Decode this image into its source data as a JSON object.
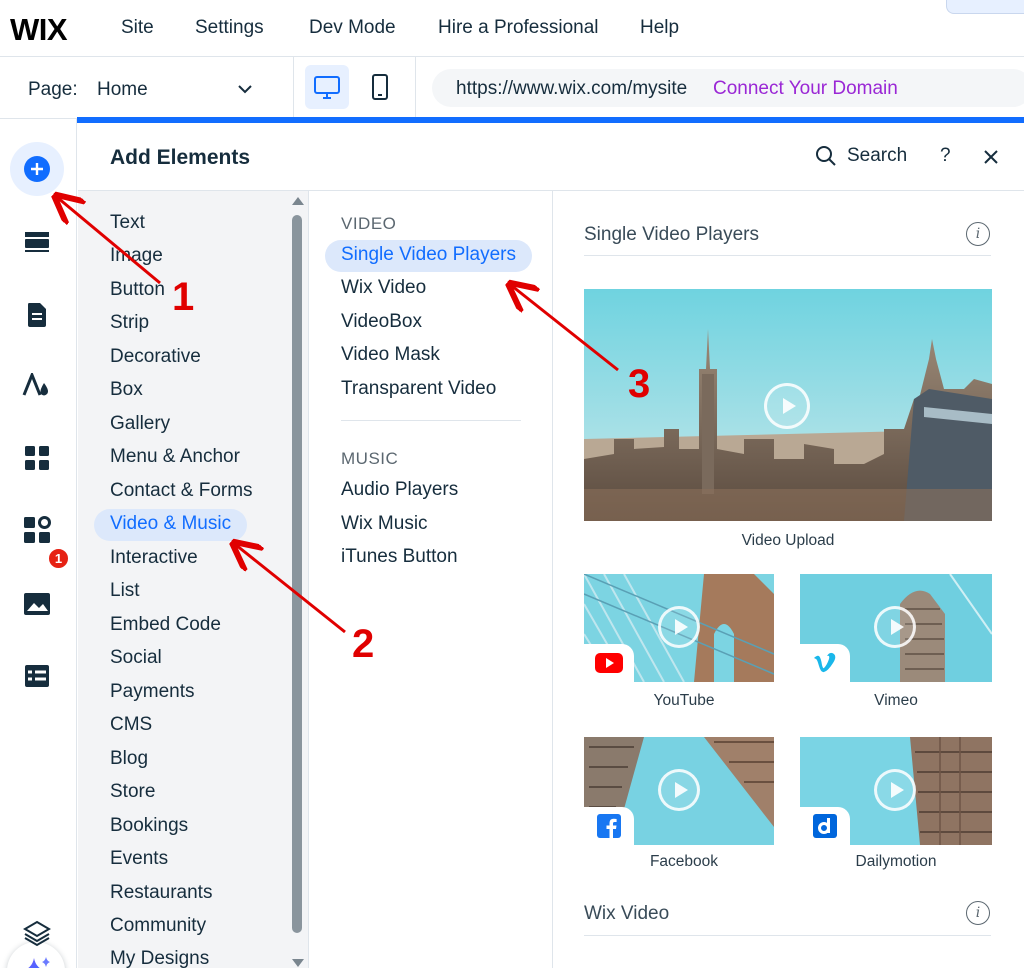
{
  "app": {
    "logo": "WIX"
  },
  "top_menu": [
    "Site",
    "Settings",
    "Dev Mode",
    "Hire a Professional",
    "Help"
  ],
  "page_bar": {
    "page_label": "Page:",
    "page_value": "Home",
    "url": "https://www.wix.com/mysite",
    "connect_domain": "Connect Your Domain"
  },
  "left_rail": {
    "apps_badge": "1",
    "icons": [
      "add-elements-icon",
      "sections-icon",
      "pages-icon",
      "theme-icon",
      "apps-icon",
      "business-apps-icon",
      "media-icon",
      "cms-icon",
      "ai-assistant-icon",
      "layers-icon"
    ]
  },
  "panel": {
    "title": "Add Elements",
    "search_label": "Search",
    "help": "?",
    "categories": [
      "Text",
      "Image",
      "Button",
      "Strip",
      "Decorative",
      "Box",
      "Gallery",
      "Menu & Anchor",
      "Contact & Forms",
      "Video & Music",
      "Interactive",
      "List",
      "Embed Code",
      "Social",
      "Payments",
      "CMS",
      "Blog",
      "Store",
      "Bookings",
      "Events",
      "Restaurants",
      "Community",
      "My Designs"
    ],
    "selected_category": "Video & Music",
    "video_heading": "VIDEO",
    "video_items": [
      "Single Video Players",
      "Wix Video",
      "VideoBox",
      "Video Mask",
      "Transparent Video"
    ],
    "music_heading": "MUSIC",
    "music_items": [
      "Audio Players",
      "Wix Music",
      "iTunes Button"
    ],
    "selected_subcategory": "Single Video Players",
    "preview": {
      "section_title": "Single Video Players",
      "main_caption": "Video Upload",
      "players": [
        "YouTube",
        "Vimeo",
        "Facebook",
        "Dailymotion"
      ],
      "next_section_title": "Wix Video"
    }
  },
  "annotations": [
    "1",
    "2",
    "3"
  ],
  "colors": {
    "accent": "#116dff",
    "domain_link": "#9a27d5",
    "annotation": "#e00000",
    "youtube": "#ff0000",
    "vimeo": "#1ab7ea",
    "facebook": "#1877f2",
    "dailymotion": "#0066dc"
  }
}
